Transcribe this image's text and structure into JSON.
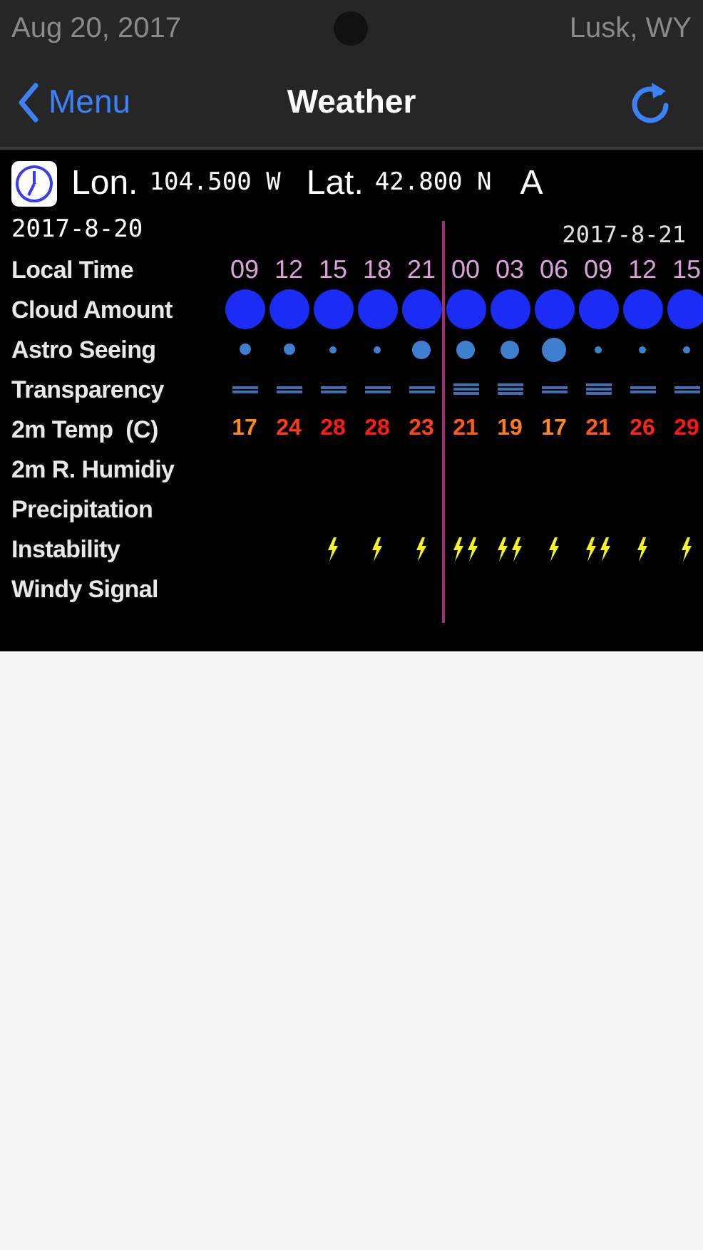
{
  "status_bar": {
    "date": "Aug 20, 2017",
    "location": "Lusk, WY"
  },
  "nav": {
    "back": "Menu",
    "title": "Weather"
  },
  "forecast": {
    "lon_label": "Lon.",
    "lon_value": "104.500 W",
    "lat_label": "Lat.",
    "lat_value": "42.800 N",
    "cut_label": "A",
    "date_1": "2017-8-20",
    "date_2": "2017-8-21",
    "row_labels": [
      "Local Time",
      "Cloud Amount",
      "Astro Seeing",
      "Transparency",
      "2m Temp  (C)",
      "2m R. Humidiy",
      "Precipitation",
      "Instability",
      "Windy Signal"
    ],
    "times": [
      "09",
      "12",
      "15",
      "18",
      "21",
      "00",
      "03",
      "06",
      "09",
      "12",
      "15"
    ],
    "cloud": [
      {
        "kind": "full"
      },
      {
        "kind": "full"
      },
      {
        "kind": "full"
      },
      {
        "kind": "full"
      },
      {
        "kind": "full"
      },
      {
        "kind": "full"
      },
      {
        "kind": "full"
      },
      {
        "kind": "full"
      },
      {
        "kind": "full"
      },
      {
        "kind": "full"
      },
      {
        "kind": "full"
      }
    ],
    "seeing": [
      {
        "kind": "small"
      },
      {
        "kind": "small"
      },
      {
        "kind": "tiny"
      },
      {
        "kind": "tiny"
      },
      {
        "kind": "medium"
      },
      {
        "kind": "medium"
      },
      {
        "kind": "medium"
      },
      {
        "kind": "large"
      },
      {
        "kind": "tiny"
      },
      {
        "kind": "tiny"
      },
      {
        "kind": "tiny"
      }
    ],
    "transparency": [
      {
        "kind": "double"
      },
      {
        "kind": "double"
      },
      {
        "kind": "double"
      },
      {
        "kind": "double"
      },
      {
        "kind": "double"
      },
      {
        "kind": "triple"
      },
      {
        "kind": "triple"
      },
      {
        "kind": "double"
      },
      {
        "kind": "triple"
      },
      {
        "kind": "double"
      },
      {
        "kind": "double"
      }
    ],
    "temps": [
      {
        "text": "17",
        "color": "#ff8a1c"
      },
      {
        "text": "24",
        "color": "#ff3a14"
      },
      {
        "text": "28",
        "color": "#ff1a14"
      },
      {
        "text": "28",
        "color": "#ff1a14"
      },
      {
        "text": "23",
        "color": "#ff4414"
      },
      {
        "text": "21",
        "color": "#ff5a16"
      },
      {
        "text": "19",
        "color": "#ff7a1a"
      },
      {
        "text": "17",
        "color": "#ff8a1c"
      },
      {
        "text": "21",
        "color": "#ff5a16"
      },
      {
        "text": "26",
        "color": "#ff2414"
      },
      {
        "text": "29",
        "color": "#ff1414"
      }
    ],
    "instability": [
      {
        "kind": "none"
      },
      {
        "kind": "none"
      },
      {
        "kind": "single"
      },
      {
        "kind": "single"
      },
      {
        "kind": "single"
      },
      {
        "kind": "double"
      },
      {
        "kind": "double"
      },
      {
        "kind": "single"
      },
      {
        "kind": "double"
      },
      {
        "kind": "single"
      },
      {
        "kind": "single"
      }
    ]
  }
}
